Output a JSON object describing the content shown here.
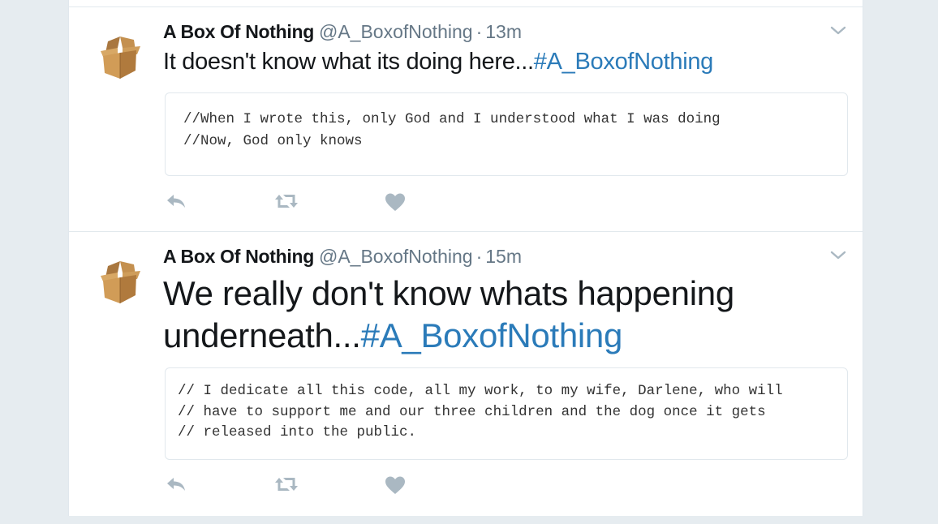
{
  "colors": {
    "hashtag": "#2b7bb9",
    "meta_gray": "#657786",
    "icon_gray": "#aab8c2",
    "background": "#e6ecf0"
  },
  "tweets": [
    {
      "name": "A Box Of Nothing",
      "handle": "@A_BoxofNothing",
      "separator": "·",
      "time": "13m",
      "text": "It doesn't know what its doing here...",
      "hashtag": "#A_BoxofNothing",
      "code": "//When I wrote this, only God and I understood what I was doing\n//Now, God only knows",
      "icons": [
        "box-avatar",
        "chevron-down-icon",
        "reply-icon",
        "retweet-icon",
        "heart-icon"
      ]
    },
    {
      "name": "A Box Of Nothing",
      "handle": "@A_BoxofNothing",
      "separator": "·",
      "time": "15m",
      "text": "We really don't know whats happening underneath...",
      "hashtag": "#A_BoxofNothing",
      "code": "// I dedicate all this code, all my work, to my wife, Darlene, who will\n// have to support me and our three children and the dog once it gets\n// released into the public.",
      "icons": [
        "box-avatar",
        "chevron-down-icon",
        "reply-icon",
        "retweet-icon",
        "heart-icon"
      ]
    }
  ]
}
